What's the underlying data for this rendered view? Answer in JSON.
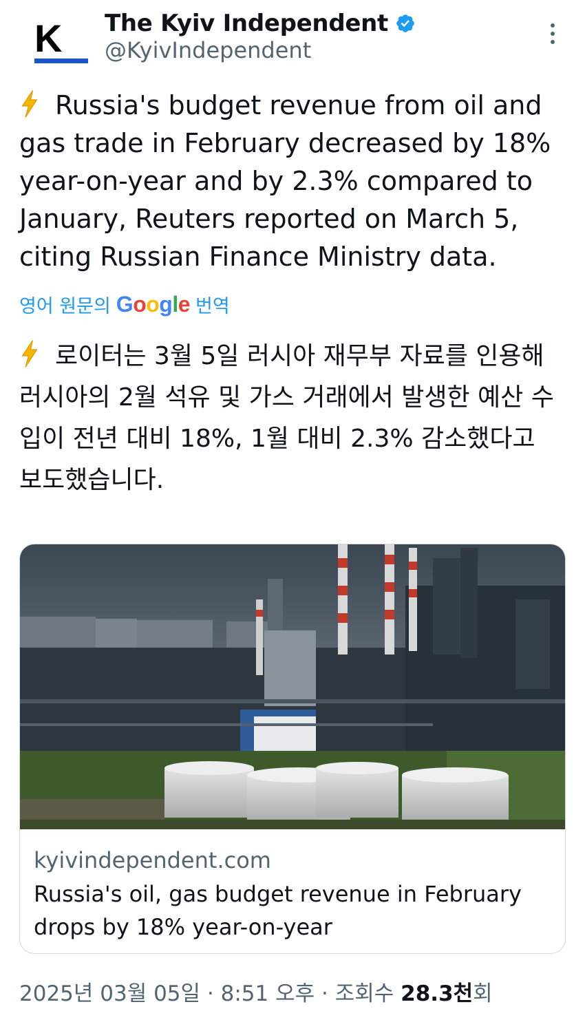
{
  "author": {
    "display_name": "The Kyiv Independent",
    "handle": "@KyivIndependent",
    "avatar_letter": "K",
    "verified": true
  },
  "tweet": {
    "text": "Russia's budget revenue from oil and gas trade in February decreased by 18% year-on-year and by 2.3% compared to January, Reuters reported on March 5, citing Russian Finance Ministry data.",
    "leading_icon": "high-voltage-emoji"
  },
  "translation": {
    "label_prefix": "영어 원문의",
    "brand": "Google",
    "label_suffix": "번역",
    "text": "로이터는 3월 5일 러시아 재무부 자료를 인용해 러시아의 2월 석유 및 가스 거래에서 발생한 예산 수입이 전년 대비 18%, 1월 대비 2.3% 감소했다고 보도했습니다."
  },
  "card": {
    "domain": "kyivindependent.com",
    "title": "Russia's oil, gas budget revenue in February drops by 18% year-on-year"
  },
  "meta": {
    "date": "2025년 03월 05일",
    "separator": "·",
    "time": "8:51 오후",
    "views_label": "조회수",
    "views_count": "28.3천",
    "views_unit": "회"
  },
  "colors": {
    "accent": "#1d9bf0",
    "secondary_text": "#536471",
    "border": "#cfd9de"
  }
}
